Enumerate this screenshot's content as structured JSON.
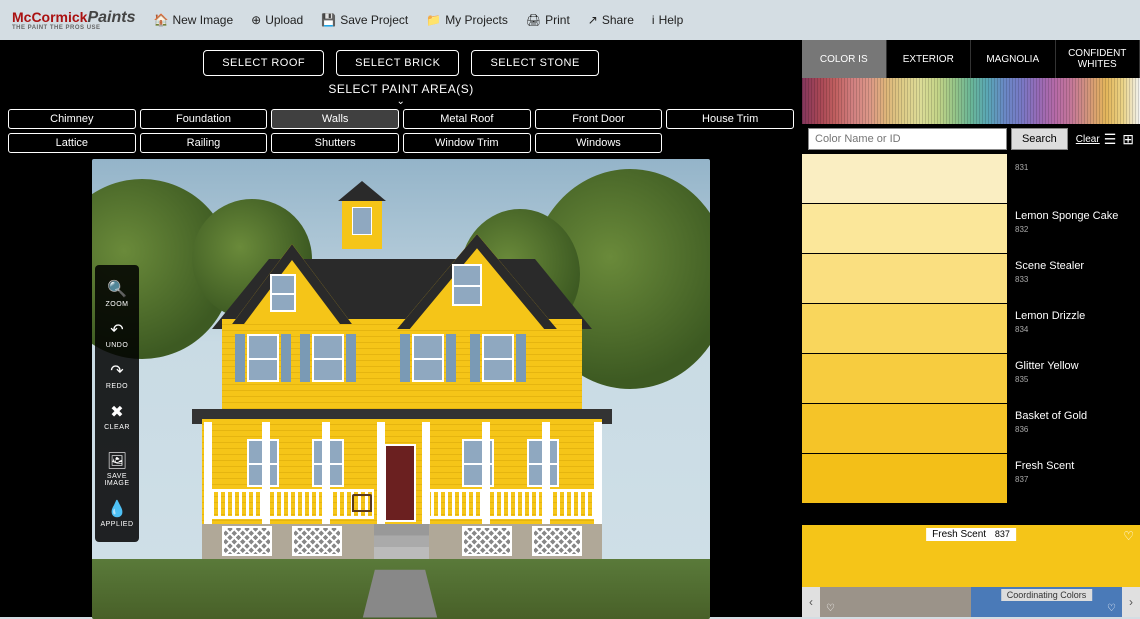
{
  "brand": {
    "part1": "McCormick",
    "part2": "Paints",
    "tagline": "THE PAINT THE PROS USE"
  },
  "topbar": [
    {
      "icon": "🏠",
      "label": "New Image"
    },
    {
      "icon": "⊕",
      "label": "Upload"
    },
    {
      "icon": "💾",
      "label": "Save Project"
    },
    {
      "icon": "📁",
      "label": "My Projects"
    },
    {
      "icon": "🖨",
      "label": "Print"
    },
    {
      "icon": "↗",
      "label": "Share"
    },
    {
      "icon": "i",
      "label": "Help"
    }
  ],
  "selectButtons": [
    "SELECT ROOF",
    "SELECT BRICK",
    "SELECT STONE"
  ],
  "paintAreaLabel": "SELECT PAINT AREA(S)",
  "areas": [
    {
      "label": "Chimney",
      "active": false
    },
    {
      "label": "Foundation",
      "active": false
    },
    {
      "label": "Walls",
      "active": true
    },
    {
      "label": "Metal Roof",
      "active": false
    },
    {
      "label": "Front Door",
      "active": false
    },
    {
      "label": "House Trim",
      "active": false
    },
    {
      "label": "Lattice",
      "active": false
    },
    {
      "label": "Railing",
      "active": false
    },
    {
      "label": "Shutters",
      "active": false
    },
    {
      "label": "Window Trim",
      "active": false
    },
    {
      "label": "Windows",
      "active": false
    }
  ],
  "tools": [
    {
      "icon": "🔍",
      "label": "ZOOM"
    },
    {
      "icon": "↶",
      "label": "UNDO"
    },
    {
      "icon": "↷",
      "label": "REDO"
    },
    {
      "icon": "✖",
      "label": "CLEAR"
    },
    {
      "gap": true
    },
    {
      "icon": "🖼",
      "label": "SAVE IMAGE"
    },
    {
      "icon": "💧",
      "label": "APPLIED"
    }
  ],
  "tabs": [
    {
      "label": "COLOR IS",
      "active": true
    },
    {
      "label": "EXTERIOR",
      "active": false
    },
    {
      "label": "MAGNOLIA",
      "active": false
    },
    {
      "label": "CONFIDENT WHITES",
      "active": false
    }
  ],
  "search": {
    "placeholder": "Color Name or ID",
    "button": "Search",
    "clear": "Clear"
  },
  "swatches": [
    {
      "name": "",
      "id": "831",
      "color": "#faeec2"
    },
    {
      "name": "Lemon Sponge Cake",
      "id": "832",
      "color": "#fbe79a"
    },
    {
      "name": "Scene Stealer",
      "id": "833",
      "color": "#fadf80"
    },
    {
      "name": "Lemon Drizzle",
      "id": "834",
      "color": "#f9d65c"
    },
    {
      "name": "Glitter Yellow",
      "id": "835",
      "color": "#f7cc3f"
    },
    {
      "name": "Basket of Gold",
      "id": "836",
      "color": "#f5c428"
    },
    {
      "name": "Fresh Scent",
      "id": "837",
      "color": "#f3bf18"
    }
  ],
  "selected": {
    "name": "Fresh Scent",
    "id": "837",
    "color": "#f5c518"
  },
  "coordLabel": "Coordinating Colors",
  "coordColors": [
    {
      "color": "#9b9389"
    },
    {
      "color": "#4a7ab8"
    }
  ]
}
